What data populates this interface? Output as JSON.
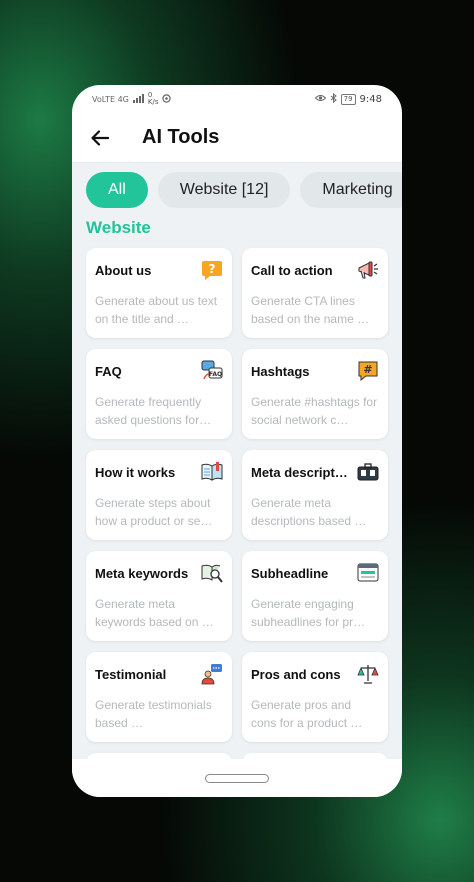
{
  "status_bar": {
    "left": "VoLTE 4G",
    "net_speed_value": "0",
    "net_speed_unit": "K/s",
    "battery": "79",
    "time": "9:48"
  },
  "header": {
    "title": "AI Tools",
    "back_icon": "arrow-left-icon"
  },
  "filters": [
    {
      "label": "All",
      "active": true
    },
    {
      "label": "Website [12]",
      "active": false
    },
    {
      "label": "Marketing",
      "active": false
    }
  ],
  "section": {
    "title": "Website"
  },
  "tools": [
    {
      "title": "About us",
      "desc": "Generate about us text on the title and …",
      "icon": "question-bubble-icon"
    },
    {
      "title": "Call to action",
      "desc": "Generate CTA lines based on the name …",
      "icon": "megaphone-icon"
    },
    {
      "title": "FAQ",
      "desc": "Generate frequently asked questions for…",
      "icon": "faq-chat-icon"
    },
    {
      "title": "Hashtags",
      "desc": "Generate #hashtags for social network c…",
      "icon": "hashtag-icon"
    },
    {
      "title": "How it works",
      "desc": "Generate steps about how a product or se…",
      "icon": "open-book-icon"
    },
    {
      "title": "Meta descript…",
      "desc": "Generate meta descriptions based …",
      "icon": "briefcase-icon"
    },
    {
      "title": "Meta keywords",
      "desc": "Generate meta keywords based on …",
      "icon": "book-search-icon"
    },
    {
      "title": "Subheadline",
      "desc": "Generate engaging subheadlines for pr…",
      "icon": "browser-window-icon"
    },
    {
      "title": "Testimonial",
      "desc": "Generate testimonials based …",
      "icon": "testimonial-user-icon"
    },
    {
      "title": "Pros and cons",
      "desc": "Generate pros and cons for a product …",
      "icon": "balance-scale-icon"
    }
  ],
  "colors": {
    "accent": "#22c49a",
    "chip_bg": "#e2e7ea",
    "content_bg": "#eef2f4",
    "desc_text": "#b4b9bd"
  }
}
